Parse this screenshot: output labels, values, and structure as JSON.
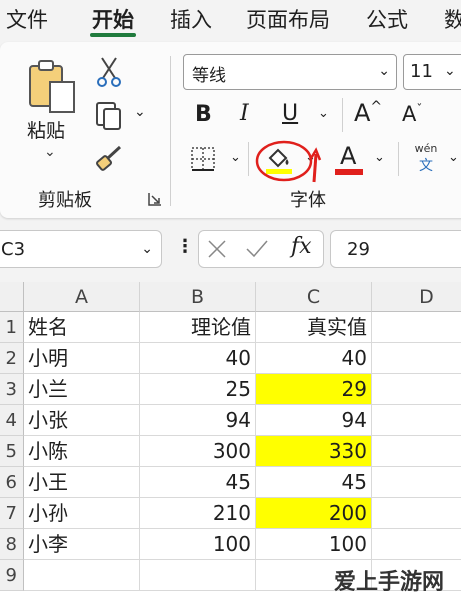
{
  "menu": {
    "tabs": [
      "文件",
      "开始",
      "插入",
      "页面布局",
      "公式",
      "数"
    ],
    "active": "开始"
  },
  "ribbon": {
    "clipboard": {
      "paste_label": "粘贴",
      "group_label": "剪贴板"
    },
    "font": {
      "font_name": "等线",
      "font_size": "11",
      "bold_label": "B",
      "italic_label": "I",
      "underline_label": "U",
      "grow_label": "A^",
      "shrink_label": "A˅",
      "font_color_label": "A",
      "phonetic_top": "wén",
      "phonetic_bottom": "文",
      "group_label": "字体",
      "fill_color": "#ffff00",
      "font_color": "#e0201c",
      "annotation_color": "#e0201c"
    }
  },
  "formula_bar": {
    "name_box": "C3",
    "fx_label": "fx",
    "value": "29"
  },
  "sheet": {
    "columns": [
      "A",
      "B",
      "C",
      "D"
    ],
    "row_numbers": [
      "1",
      "2",
      "3",
      "4",
      "5",
      "6",
      "7",
      "8",
      "9"
    ],
    "rows": [
      [
        "姓名",
        "理论值",
        "真实值"
      ],
      [
        "小明",
        "40",
        "40"
      ],
      [
        "小兰",
        "25",
        "29"
      ],
      [
        "小张",
        "94",
        "94"
      ],
      [
        "小陈",
        "300",
        "330"
      ],
      [
        "小王",
        "45",
        "45"
      ],
      [
        "小孙",
        "210",
        "200"
      ],
      [
        "小李",
        "100",
        "100"
      ]
    ],
    "highlight_color": "#ffff00"
  },
  "watermark": "爱上手游网"
}
